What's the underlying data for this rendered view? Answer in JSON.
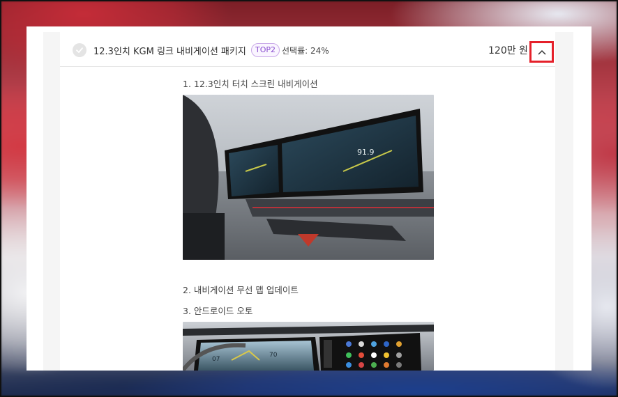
{
  "option": {
    "title": "12.3인치 KGM 링크 내비게이션 패키지",
    "badge": "TOP2",
    "select_rate": "선택률: 24%",
    "price": "120만 원"
  },
  "features": [
    {
      "label": "1. 12.3인치 터치 스크린 내비게이션"
    },
    {
      "label": "2. 내비게이션 무선 맵 업데이트"
    },
    {
      "label": "3. 안드로이드 오토"
    }
  ],
  "photo1": {
    "speed_readout": "91.9"
  },
  "photo2": {
    "gauge_left": "07",
    "gauge_right": "70"
  },
  "colors": {
    "accent_red": "#e5202a",
    "badge_purple": "#8a4fcf"
  },
  "icons": {
    "check": "check-icon",
    "collapse": "chevron-up-icon"
  }
}
